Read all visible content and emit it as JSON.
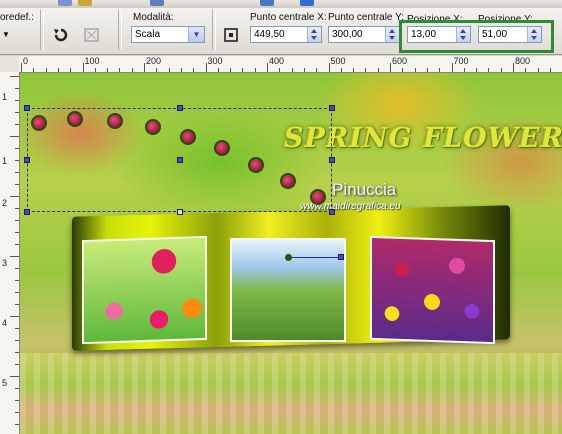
{
  "toolbar": {
    "preset_label": "oredef.:",
    "mode_label": "Modalità:",
    "mode_value": "Scala",
    "center_x_label": "Punto centrale X:",
    "center_x_value": "449,50",
    "center_y_label": "Punto centrale Y:",
    "center_y_value": "300,00",
    "pos_x_label": "Posizione X:",
    "pos_x_value": "13,00",
    "pos_y_label": "Posizione Y:",
    "pos_y_value": "51,00",
    "highlight_color": "#2f8a35"
  },
  "rulers": {
    "h_ticks": [
      "0",
      "100",
      "200",
      "300",
      "400",
      "500",
      "600",
      "700",
      "800"
    ],
    "v_ticks": [
      "1",
      "1",
      "2",
      "3",
      "4",
      "5"
    ]
  },
  "canvas": {
    "title": "SPRING FLOWERS",
    "author": "Pinuccia",
    "url": "www.maidiregrafica.eu"
  },
  "colors": {
    "selection": "#2a2a9a",
    "handle": "#4a4ac8"
  }
}
